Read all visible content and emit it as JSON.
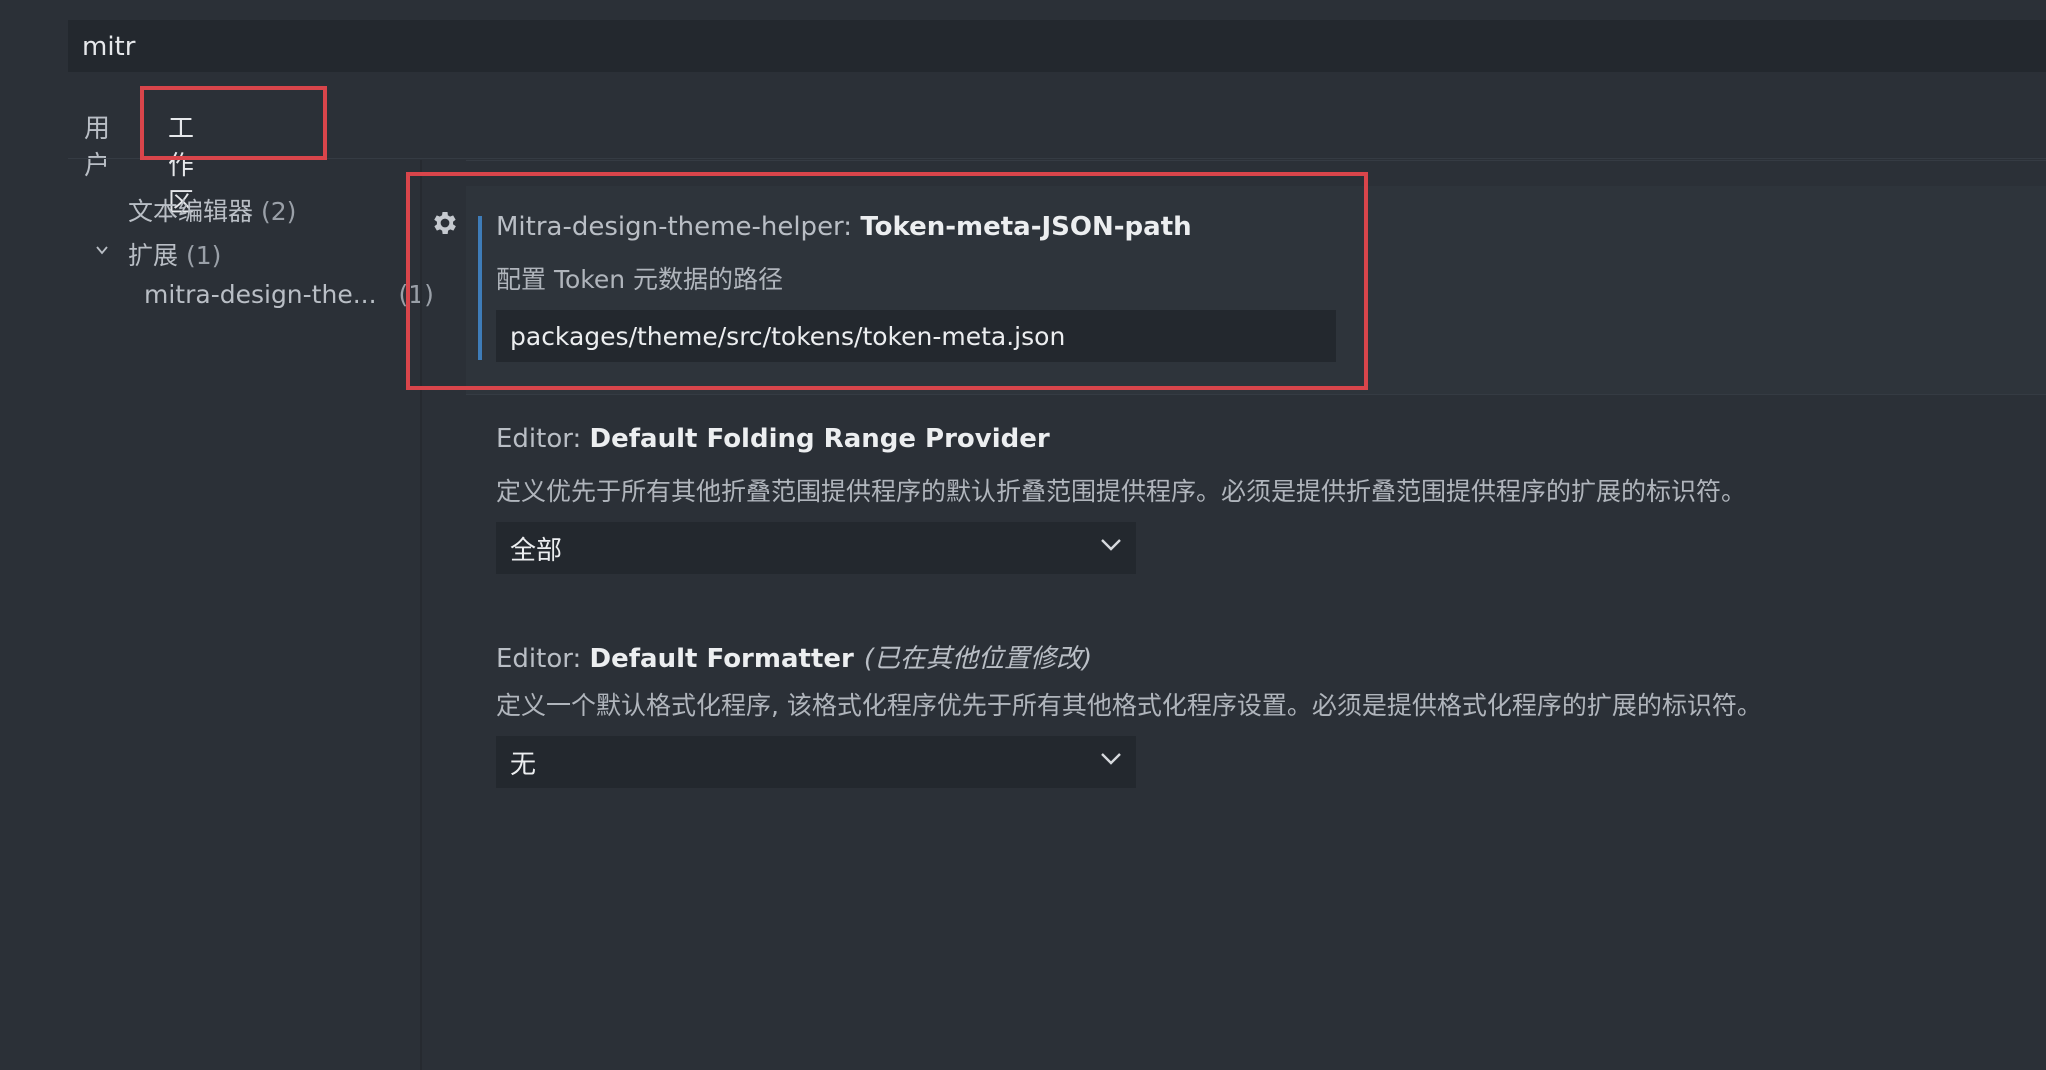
{
  "search": {
    "value": "mitr"
  },
  "scope_tabs": {
    "user": "用户",
    "workspace": "工作区"
  },
  "toc": {
    "text_editor": {
      "label": "文本编辑器",
      "count": "(2)"
    },
    "extensions": {
      "label": "扩展",
      "count": "(1)"
    },
    "extension_item": {
      "label": "mitra-design-the...",
      "count": "(1)"
    }
  },
  "settings": [
    {
      "category": "Mitra-design-theme-helper: ",
      "key": "Token-meta-JSON-path",
      "description": "配置 Token 元数据的路径",
      "value": "packages/theme/src/tokens/token-meta.json"
    },
    {
      "category": "Editor: ",
      "key": "Default Folding Range Provider",
      "description": "定义优先于所有其他折叠范围提供程序的默认折叠范围提供程序。必须是提供折叠范围提供程序的扩展的标识符。",
      "selected": "全部"
    },
    {
      "category": "Editor: ",
      "key": "Default Formatter",
      "modified_note": "(已在其他位置修改)",
      "description": "定义一个默认格式化程序, 该格式化程序优先于所有其他格式化程序设置。必须是提供格式化程序的扩展的标识符。",
      "selected": "无"
    }
  ],
  "icons": {
    "gear": "gear-icon",
    "chevron_down": "chevron-down-icon",
    "chevron_expand": "chevron-expanded-icon"
  },
  "colors": {
    "background": "#2b3037",
    "input_bg": "#23282e",
    "annotation_red": "#d9454b",
    "focus_blue": "#3e7cb8"
  }
}
